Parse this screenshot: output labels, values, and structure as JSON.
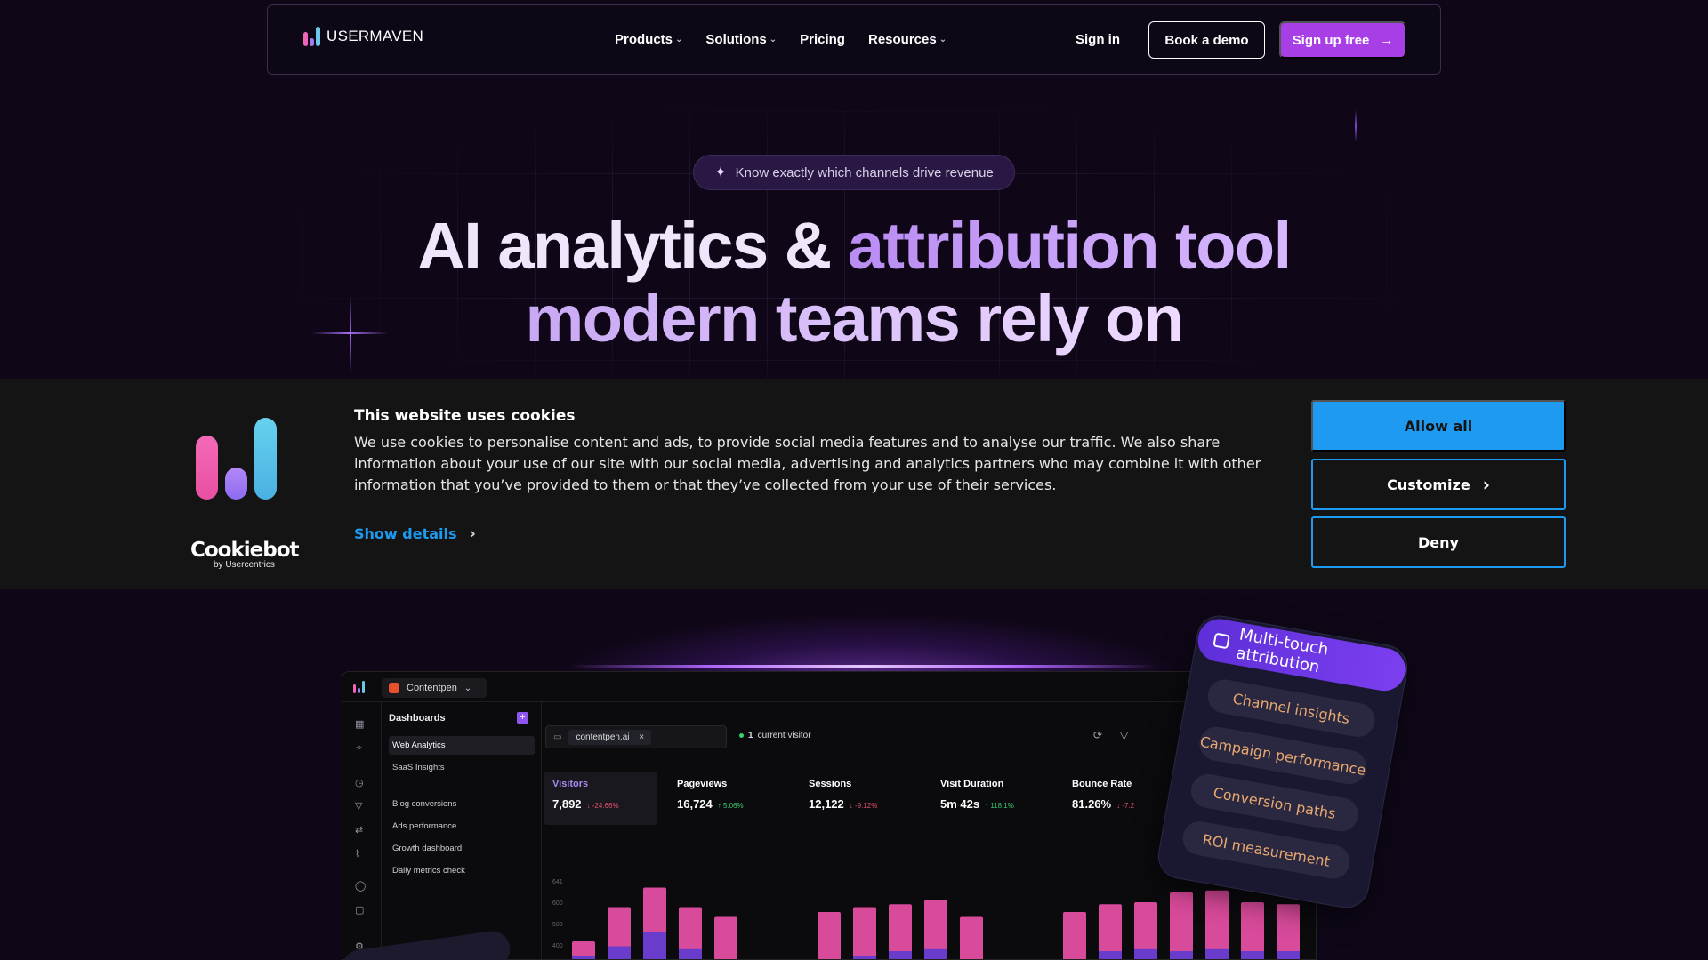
{
  "nav": {
    "brand": "USERMAVEN",
    "items": [
      {
        "label": "Products",
        "dropdown": true
      },
      {
        "label": "Solutions",
        "dropdown": true
      },
      {
        "label": "Pricing",
        "dropdown": false
      },
      {
        "label": "Resources",
        "dropdown": true
      }
    ],
    "sign_in": "Sign in",
    "book_demo": "Book a demo",
    "sign_up": "Sign up free",
    "sign_up_arrow": "→"
  },
  "hero": {
    "pill_text": "Know exactly which channels drive revenue",
    "title_plain": "AI analytics & ",
    "title_accent": "attribution tool",
    "title_line2": "modern teams rely on"
  },
  "cookie": {
    "brand": "Cookiebot",
    "brand_sub": "by Usercentrics",
    "title": "This website uses cookies",
    "text": "We use cookies to personalise content and ads, to provide social media features and to analyse our traffic. We also share information about your use of our site with our social media, advertising and analytics partners who may combine it with other information that you’ve provided to them or that they’ve collected from your use of their services.",
    "show_details": "Show details",
    "allow_all": "Allow all",
    "customize": "Customize",
    "deny": "Deny"
  },
  "dashboard": {
    "workspace": "Contentpen",
    "sidebar_title": "Dashboards",
    "sidebar_items": [
      "Web Analytics",
      "SaaS Insights",
      "Blog conversions",
      "Ads performance",
      "Growth dashboard",
      "Daily metrics check"
    ],
    "filter_chip": "contentpen.ai",
    "live_count": "1",
    "live_label": "current visitor",
    "metrics": [
      {
        "name": "Visitors",
        "value": "7,892",
        "delta": "↓ -24.66%",
        "dir": "down"
      },
      {
        "name": "Pageviews",
        "value": "16,724",
        "delta": "↑ 5.06%",
        "dir": "up"
      },
      {
        "name": "Sessions",
        "value": "12,122",
        "delta": "↓ -9.12%",
        "dir": "down"
      },
      {
        "name": "Visit Duration",
        "value": "5m 42s",
        "delta": "↑ 118.1%",
        "dir": "up"
      },
      {
        "name": "Bounce Rate",
        "value": "81.26%",
        "delta": "↓ -7.2",
        "dir": "down"
      }
    ],
    "y_ticks": [
      "641",
      "600",
      "500",
      "400"
    ],
    "bars": [
      {
        "pink": 0.2,
        "purple": 0.05
      },
      {
        "pink": 0.55,
        "purple": 0.15
      },
      {
        "pink": 0.75,
        "purple": 0.3
      },
      {
        "pink": 0.55,
        "purple": 0.12
      },
      {
        "pink": 0.45,
        "purple": 0.0
      },
      {
        "pink": 0.5,
        "purple": 0.0
      },
      {
        "pink": 0.55,
        "purple": 0.05
      },
      {
        "pink": 0.58,
        "purple": 0.1
      },
      {
        "pink": 0.62,
        "purple": 0.12
      },
      {
        "pink": 0.45,
        "purple": 0.0
      },
      {
        "pink": 0.5,
        "purple": 0.0
      },
      {
        "pink": 0.58,
        "purple": 0.1
      },
      {
        "pink": 0.6,
        "purple": 0.12
      },
      {
        "pink": 0.7,
        "purple": 0.1
      },
      {
        "pink": 0.72,
        "purple": 0.12
      },
      {
        "pink": 0.6,
        "purple": 0.1
      },
      {
        "pink": 0.58,
        "purple": 0.1
      }
    ]
  },
  "features": {
    "header": "Multi-touch attribution",
    "items": [
      "Channel insights",
      "Campaign performance",
      "Conversion paths",
      "ROI measurement"
    ]
  },
  "colors": {
    "background": "#0f0717",
    "accent_purple": "#a83fe6",
    "cookie_blue": "#1e9bf0",
    "bar_pink": "#d84a9a",
    "bar_purple": "#6a3ccc"
  }
}
